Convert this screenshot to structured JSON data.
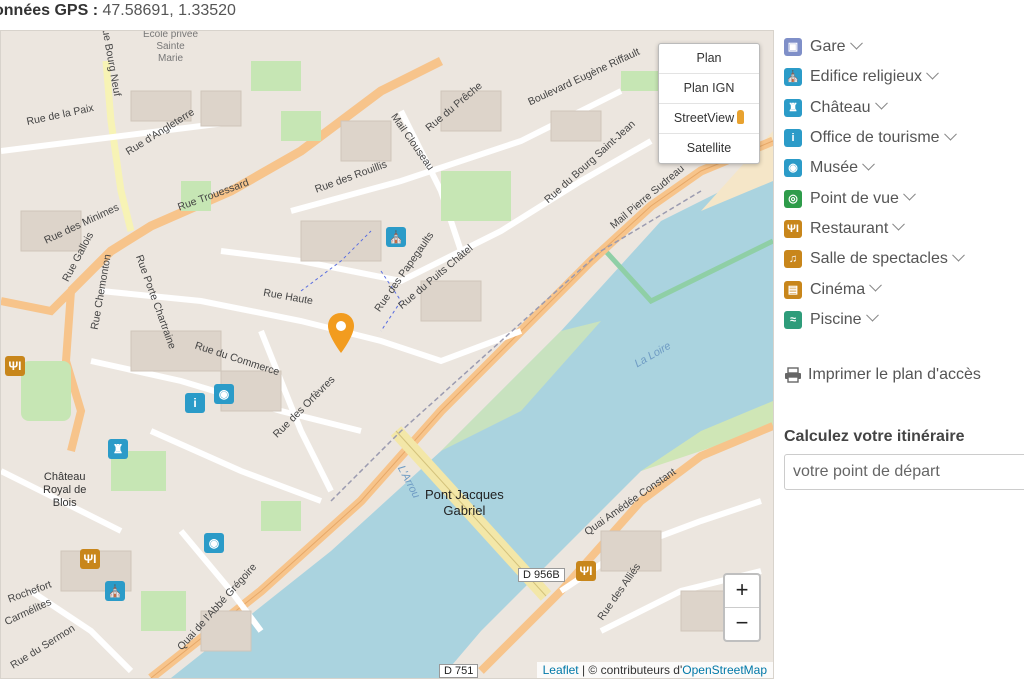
{
  "gps": {
    "label": "onnées GPS :",
    "value": "47.58691, 1.33520"
  },
  "layers": {
    "plan": "Plan",
    "plan_ign": "Plan IGN",
    "streetview": "StreetView",
    "satellite": "Satellite"
  },
  "zoom": {
    "in": "+",
    "out": "−"
  },
  "attribution": {
    "leaflet": "Leaflet",
    "sep": " | © contributeurs d'",
    "osm": "OpenStreetMap"
  },
  "map_labels": {
    "pont": "Pont Jacques\nGabriel",
    "chateau": "Château\nRoyal de\nBlois",
    "loire": "La Loire",
    "arrou": "L'Arrou",
    "d956b": "D 956B",
    "d751": "D 751",
    "ecole": "Ecole privée\nSainte\nMarie",
    "streets": {
      "angleterre": "Rue d'Angleterre",
      "trouessard": "Rue Trouessard",
      "minimes": "Rue des Minimes",
      "gallois": "Rue Gallois",
      "paix": "Rue de la Paix",
      "haute": "Rue Haute",
      "commerce": "Rue du Commerce",
      "orfevres": "Rue des Orfèvres",
      "papegaults": "Rue des Papegaults",
      "puits": "Rue du Puits Châtel",
      "rouillis": "Rue des Rouillis",
      "clouseau": "Mail Clouseau",
      "riffault": "Boulevard Eugène Riffault",
      "bourg_st_jean": "Rue du Bourg Saint-Jean",
      "pierre_sudreau": "Mail Pierre Sudreau",
      "abbe_gregoire": "Quai de l'Abbé Grégoire",
      "amedee": "Quai Amédée Constant",
      "chemonton": "Rue Chemonton",
      "porte_chartraine": "Rue Porte Chartraine",
      "bourg_neuf": "Rue Bourg Neuf",
      "sermon": "Rue du Sermon",
      "allies": "Rue des Alliés",
      "prêche": "Rue du Prêche",
      "carmelites": "Carmélites",
      "rochefort": "Rochefort"
    }
  },
  "categories": [
    {
      "label": "Gare",
      "icon": "train-icon",
      "color": "#7f8fc8",
      "glyph": "▣"
    },
    {
      "label": "Edifice religieux",
      "icon": "church-icon",
      "color": "#2b9bc8",
      "glyph": "⛪"
    },
    {
      "label": "Château",
      "icon": "castle-icon",
      "color": "#2b9bc8",
      "glyph": "♜"
    },
    {
      "label": "Office de tourisme",
      "icon": "info-icon",
      "color": "#2b9bc8",
      "glyph": "i"
    },
    {
      "label": "Musée",
      "icon": "palette-icon",
      "color": "#2b9bc8",
      "glyph": "◉"
    },
    {
      "label": "Point de vue",
      "icon": "eye-icon",
      "color": "#2e9c4a",
      "glyph": "◎"
    },
    {
      "label": "Restaurant",
      "icon": "cutlery-icon",
      "color": "#c8861b",
      "glyph": "ΨΙ"
    },
    {
      "label": "Salle de spectacles",
      "icon": "music-icon",
      "color": "#c8861b",
      "glyph": "♫"
    },
    {
      "label": "Cinéma",
      "icon": "film-icon",
      "color": "#c8861b",
      "glyph": "▤"
    },
    {
      "label": "Piscine",
      "icon": "swimmer-icon",
      "color": "#2e9c7a",
      "glyph": "≈"
    }
  ],
  "print_label": "Imprimer le plan d'accès",
  "route": {
    "title": "Calculez votre itinéraire",
    "placeholder": "votre point de départ"
  }
}
